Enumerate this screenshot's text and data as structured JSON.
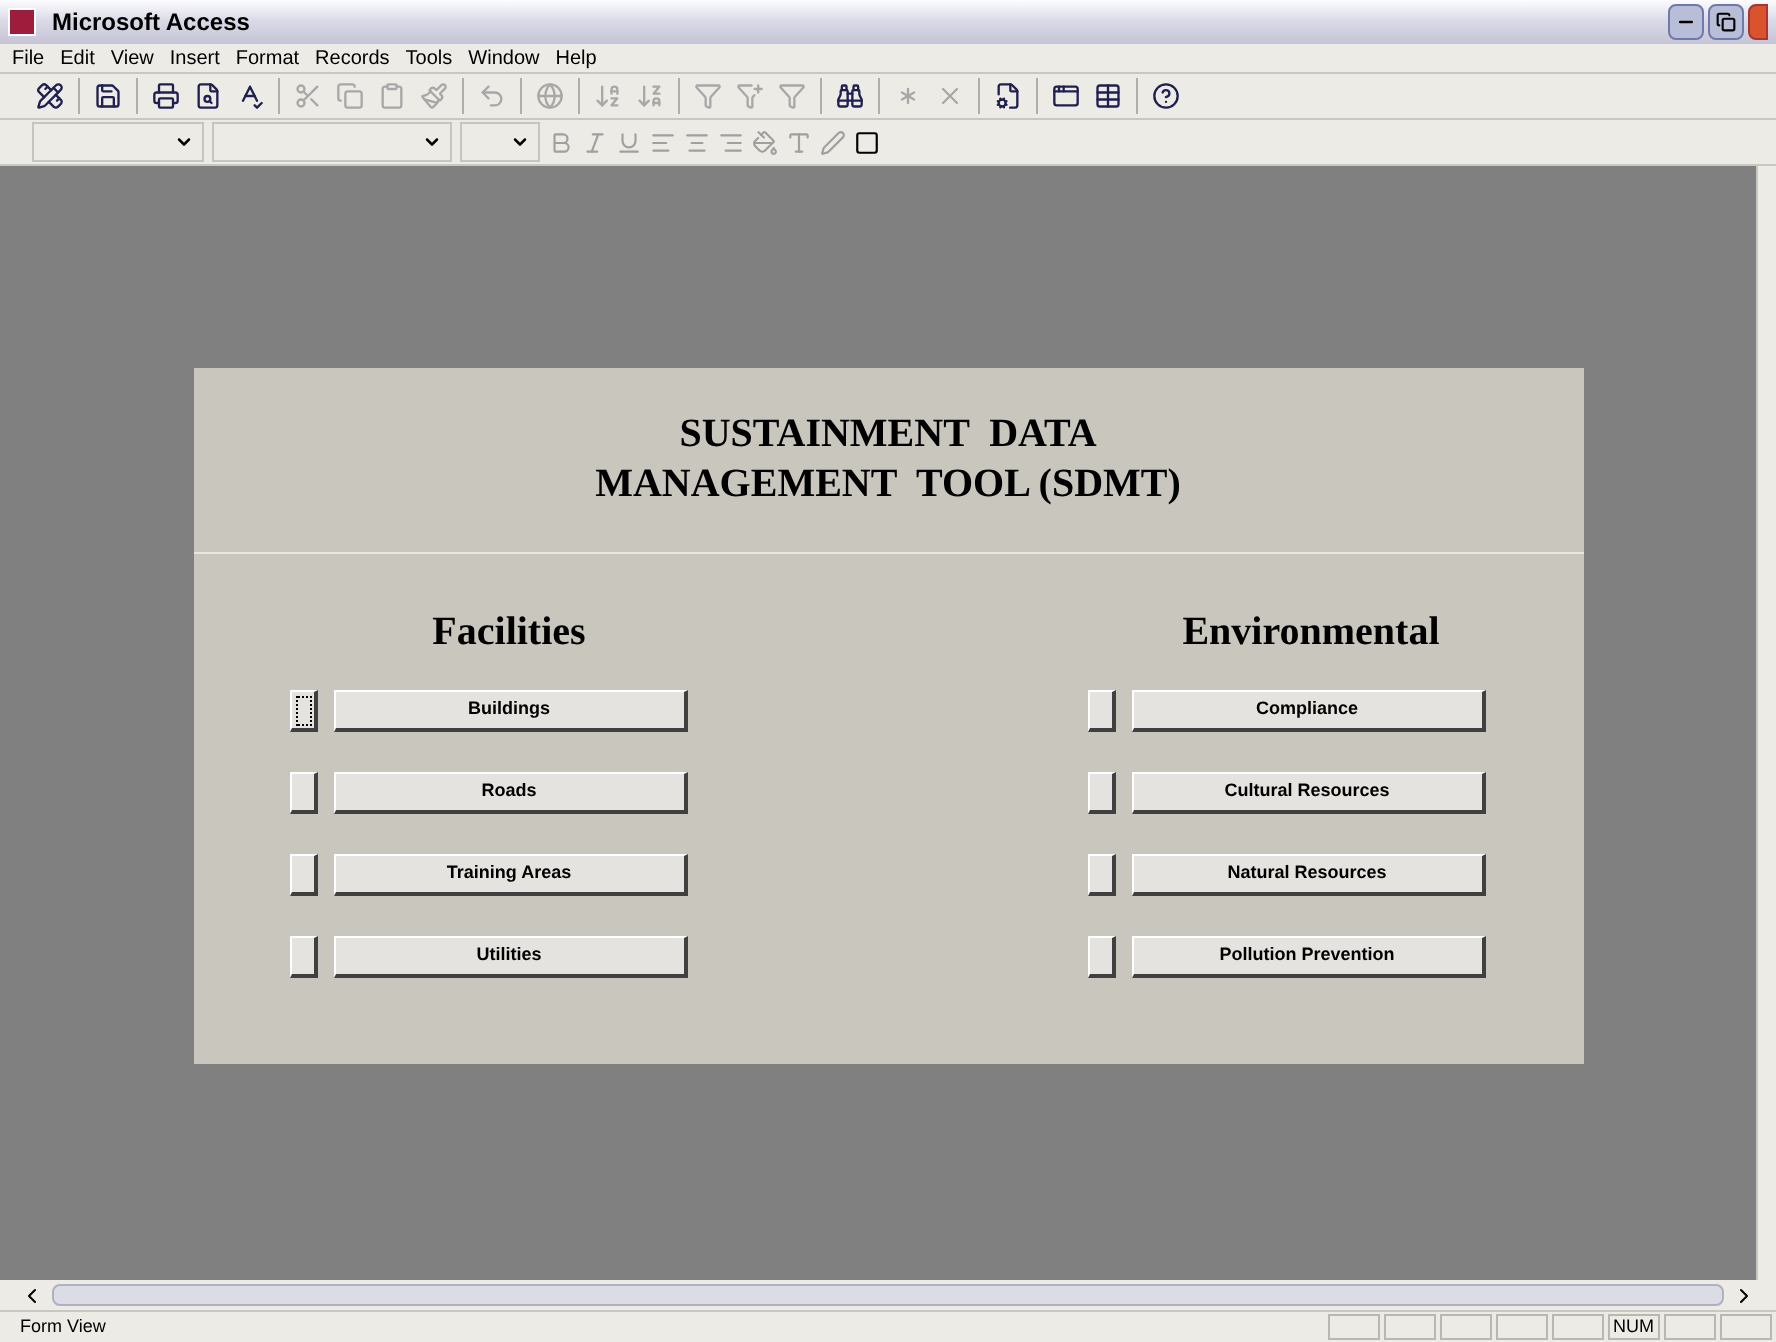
{
  "window": {
    "title": "Microsoft Access"
  },
  "menu": [
    "File",
    "Edit",
    "View",
    "Insert",
    "Format",
    "Records",
    "Tools",
    "Window",
    "Help"
  ],
  "toolbar": [
    {
      "kind": "design",
      "disabled": false
    },
    {
      "kind": "sep"
    },
    {
      "kind": "save",
      "disabled": false
    },
    {
      "kind": "sep"
    },
    {
      "kind": "print",
      "disabled": false
    },
    {
      "kind": "preview",
      "disabled": false
    },
    {
      "kind": "spell",
      "disabled": false
    },
    {
      "kind": "sep"
    },
    {
      "kind": "cut",
      "disabled": true
    },
    {
      "kind": "copy",
      "disabled": true
    },
    {
      "kind": "paste",
      "disabled": true
    },
    {
      "kind": "brush",
      "disabled": true
    },
    {
      "kind": "sep"
    },
    {
      "kind": "undo",
      "disabled": true
    },
    {
      "kind": "sep"
    },
    {
      "kind": "link",
      "disabled": true
    },
    {
      "kind": "sep"
    },
    {
      "kind": "sortasc",
      "disabled": true
    },
    {
      "kind": "sortdesc",
      "disabled": true
    },
    {
      "kind": "sep"
    },
    {
      "kind": "filter",
      "disabled": true
    },
    {
      "kind": "filterform",
      "disabled": true
    },
    {
      "kind": "funnel",
      "disabled": true
    },
    {
      "kind": "sep"
    },
    {
      "kind": "find",
      "disabled": false
    },
    {
      "kind": "sep"
    },
    {
      "kind": "newrec",
      "disabled": true
    },
    {
      "kind": "delrec",
      "disabled": true
    },
    {
      "kind": "sep"
    },
    {
      "kind": "props",
      "disabled": false
    },
    {
      "kind": "sep"
    },
    {
      "kind": "window",
      "disabled": false
    },
    {
      "kind": "newobj",
      "disabled": false
    },
    {
      "kind": "sep"
    },
    {
      "kind": "help",
      "disabled": false
    }
  ],
  "form": {
    "title_lines": [
      "SUSTAINMENT  DATA",
      "MANAGEMENT  TOOL (SDMT)"
    ],
    "groups": [
      {
        "heading": "Facilities",
        "buttons": [
          {
            "label": "Buildings",
            "focused": true
          },
          {
            "label": "Roads",
            "focused": false
          },
          {
            "label": "Training Areas",
            "focused": false
          },
          {
            "label": "Utilities",
            "focused": false
          }
        ]
      },
      {
        "heading": "Environmental",
        "buttons": [
          {
            "label": "Compliance",
            "focused": false
          },
          {
            "label": "Cultural Resources",
            "focused": false
          },
          {
            "label": "Natural Resources",
            "focused": false
          },
          {
            "label": "Pollution Prevention",
            "focused": false
          }
        ]
      }
    ]
  },
  "status_bar": {
    "text": "Form View",
    "num_indicator": "NUM"
  }
}
